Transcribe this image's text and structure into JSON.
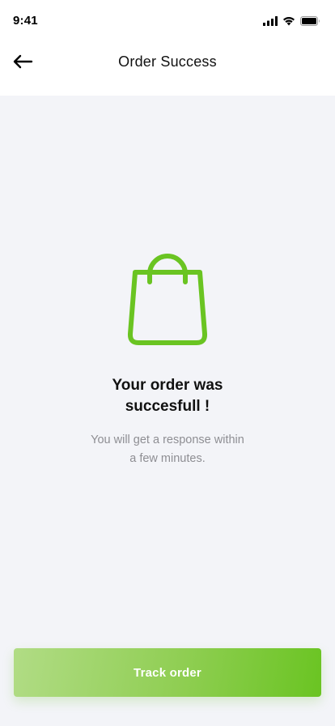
{
  "status_bar": {
    "time": "9:41",
    "icons": [
      "cellular-signal-icon",
      "wifi-icon",
      "battery-icon"
    ]
  },
  "header": {
    "back_icon": "arrow-left-icon",
    "title": "Order Success"
  },
  "main": {
    "illustration_icon": "shopping-bag-icon",
    "heading_lines": [
      "Your order was",
      "succesfull !"
    ],
    "subtext_lines": [
      "You will get a response within",
      "a few minutes."
    ]
  },
  "footer": {
    "button_label": "Track order"
  },
  "colors": {
    "accent_green": "#6ac422",
    "accent_green_light": "#b1dc85",
    "background": "#f3f4f8",
    "header_background": "#ffffff",
    "muted_text": "#8e8e93"
  }
}
